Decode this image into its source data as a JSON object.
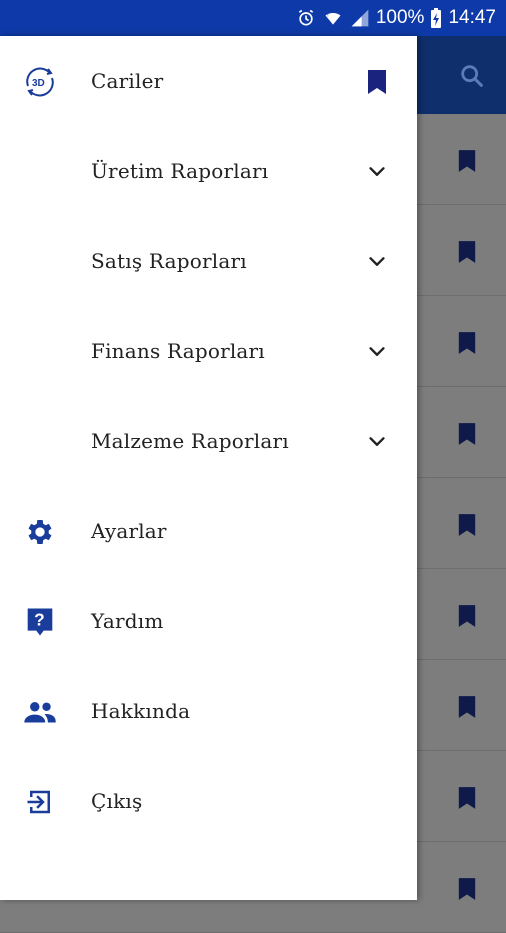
{
  "status_bar": {
    "battery": "100%",
    "time": "14:47",
    "icons": [
      "alarm-icon",
      "wifi-icon",
      "signal-icon",
      "battery-charging-icon"
    ]
  },
  "background": {
    "toolbar_icon": "search-icon",
    "row_icon": "bookmark-icon",
    "row_count": 9
  },
  "drawer": {
    "items": [
      {
        "label": "Cariler",
        "icon": "3d-rotate-icon",
        "trailing": "bookmark-icon"
      },
      {
        "label": "Üretim Raporları",
        "icon": "",
        "trailing": "chevron-down-icon"
      },
      {
        "label": "Satış Raporları",
        "icon": "",
        "trailing": "chevron-down-icon"
      },
      {
        "label": "Finans Raporları",
        "icon": "",
        "trailing": "chevron-down-icon"
      },
      {
        "label": "Malzeme Raporları",
        "icon": "",
        "trailing": "chevron-down-icon"
      },
      {
        "label": "Ayarlar",
        "icon": "gear-icon",
        "trailing": ""
      },
      {
        "label": "Yardım",
        "icon": "help-icon",
        "trailing": ""
      },
      {
        "label": "Hakkında",
        "icon": "people-icon",
        "trailing": ""
      },
      {
        "label": "Çıkış",
        "icon": "logout-icon",
        "trailing": ""
      }
    ]
  },
  "colors": {
    "status_bar": "#0d3aa8",
    "accent": "#1a3d9c",
    "bookmark": "#1a237e",
    "scrim": "#7a7a7a"
  }
}
